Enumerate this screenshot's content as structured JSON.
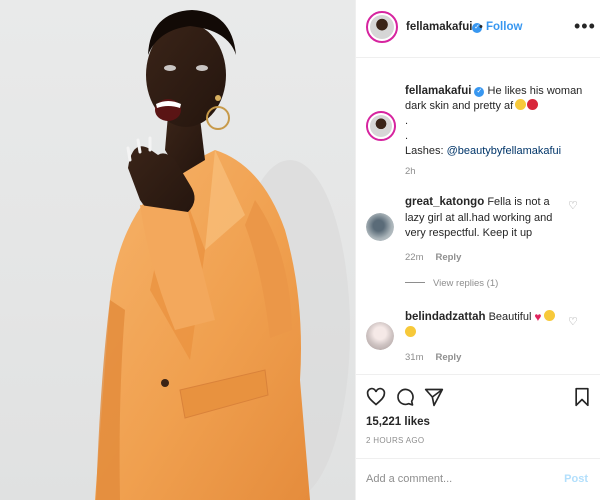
{
  "post": {
    "username": "fellamakafui",
    "follow_label": "Follow",
    "more_label": "•••"
  },
  "caption": {
    "username": "fellamakafui",
    "text": "He likes his woman dark skin and pretty af",
    "dots": ".",
    "dots2": ".",
    "lashes_prefix": "Lashes: ",
    "lashes_link": "@beautybyfellamakafui",
    "time": "2h"
  },
  "comments": [
    {
      "username": "great_katongo",
      "text": "Fella is not a lazy girl at all.had working and very respectful. Keep it up",
      "time": "22m",
      "reply_label": "Reply"
    },
    {
      "username": "belindadzattah",
      "text": "Beautiful",
      "time": "31m",
      "reply_label": "Reply"
    }
  ],
  "view_replies_label": "View replies (1)",
  "likes": "15,221 likes",
  "posted_time": "2 HOURS AGO",
  "add_comment_placeholder": "Add a comment...",
  "post_label": "Post",
  "colors": {
    "link_blue": "#3897f0",
    "blazer_orange": "#f2a455",
    "story_ring": "#d6249f",
    "muted": "#8e8e8e"
  },
  "icons": [
    "verified-badge-icon",
    "heart-icon",
    "comment-icon",
    "share-icon",
    "bookmark-icon",
    "like-comment-icon"
  ]
}
